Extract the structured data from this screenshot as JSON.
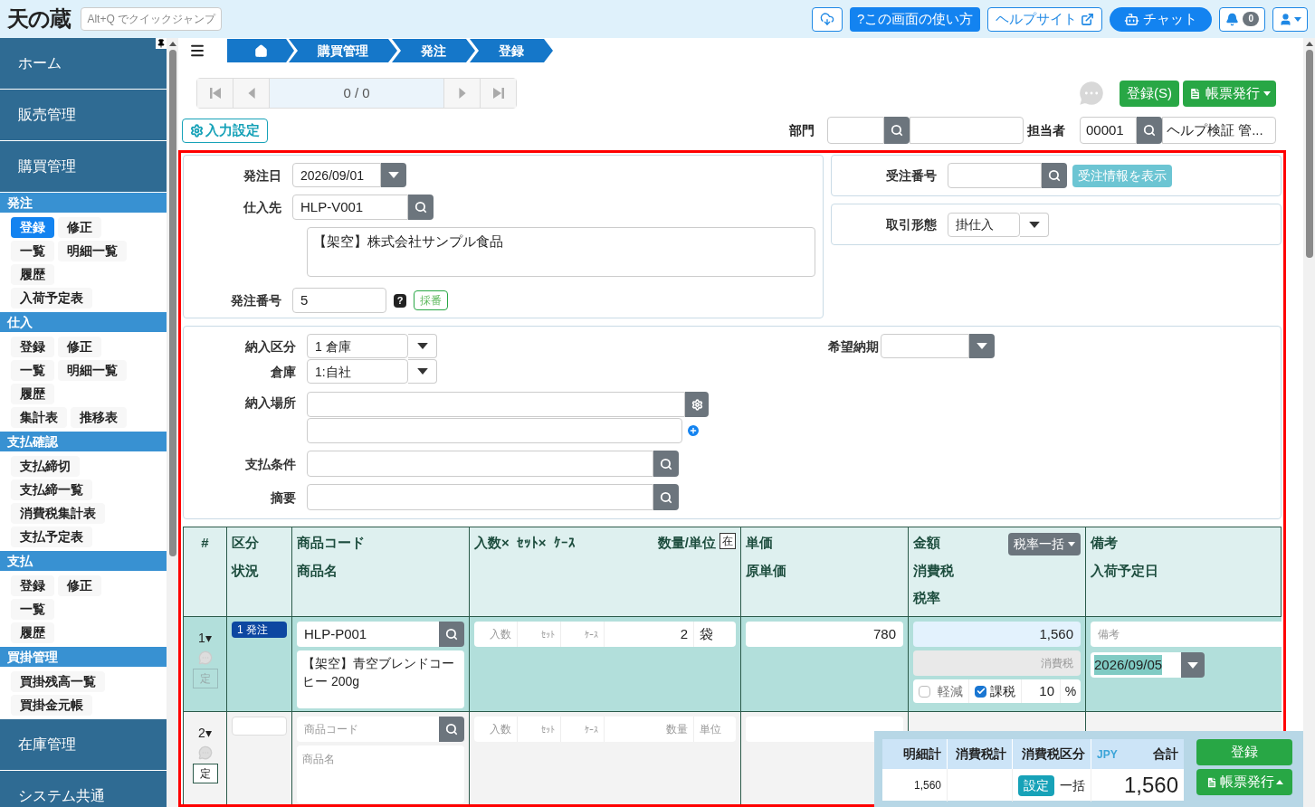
{
  "header": {
    "logo": "天の蔵",
    "quick_jump": {
      "placeholder": "Alt+Q でクイックジャンプ"
    },
    "buttons": [
      {
        "kind": "download"
      },
      {
        "kind": "help",
        "label": "?この画面の使い方"
      },
      {
        "kind": "site",
        "label": "ヘルプサイト"
      },
      {
        "kind": "chat",
        "label": "チャット"
      },
      {
        "kind": "notify",
        "badge": "0"
      },
      {
        "kind": "user"
      }
    ]
  },
  "sidebar": {
    "top": [
      {
        "label": "ホーム"
      },
      {
        "label": "販売管理"
      },
      {
        "label": "購買管理"
      }
    ],
    "sections": [
      {
        "title": "発注",
        "rows": [
          [
            {
              "label": "登録",
              "selected": true
            },
            {
              "label": "修正",
              "selected": false
            }
          ],
          [
            {
              "label": "一覧",
              "selected": false
            },
            {
              "label": "明細一覧",
              "selected": false
            }
          ],
          [
            {
              "label": "履歴",
              "selected": false
            }
          ],
          [
            {
              "label": "入荷予定表",
              "selected": false
            }
          ]
        ]
      },
      {
        "title": "仕入",
        "rows": [
          [
            {
              "label": "登録",
              "selected": false
            },
            {
              "label": "修正",
              "selected": false
            }
          ],
          [
            {
              "label": "一覧",
              "selected": false
            },
            {
              "label": "明細一覧",
              "selected": false
            }
          ],
          [
            {
              "label": "履歴",
              "selected": false
            }
          ],
          [
            {
              "label": "集計表",
              "selected": false
            },
            {
              "label": "推移表",
              "selected": false
            }
          ]
        ]
      },
      {
        "title": "支払確認",
        "rows": [
          [
            {
              "label": "支払締切",
              "selected": false
            }
          ],
          [
            {
              "label": "支払締一覧",
              "selected": false
            }
          ],
          [
            {
              "label": "消費税集計表",
              "selected": false
            }
          ],
          [
            {
              "label": "支払予定表",
              "selected": false
            }
          ]
        ]
      },
      {
        "title": "支払",
        "rows": [
          [
            {
              "label": "登録",
              "selected": false
            },
            {
              "label": "修正",
              "selected": false
            }
          ],
          [
            {
              "label": "一覧",
              "selected": false
            }
          ],
          [
            {
              "label": "履歴",
              "selected": false
            }
          ]
        ]
      },
      {
        "title": "買掛管理",
        "rows": [
          [
            {
              "label": "買掛残高一覧",
              "selected": false
            }
          ],
          [
            {
              "label": "買掛金元帳",
              "selected": false
            }
          ]
        ]
      }
    ],
    "bottom": [
      {
        "label": "在庫管理"
      },
      {
        "label": "システム共通"
      }
    ]
  },
  "breadcrumb": [
    "購買管理",
    "発注",
    "登録"
  ],
  "pager": {
    "position": "0 / 0"
  },
  "actions": {
    "register": "登録(S)",
    "print": "帳票発行"
  },
  "input_settings": "入力設定",
  "department": {
    "label": "部門"
  },
  "staff": {
    "label": "担当者",
    "code": "00001",
    "name": "ヘルプ検証 管..."
  },
  "order": {
    "date": {
      "label": "発注日",
      "value": "2026/09/01"
    },
    "supplier": {
      "label": "仕入先",
      "code": "HLP-V001",
      "name": "【架空】株式会社サンプル食品"
    },
    "number": {
      "label": "発注番号",
      "value": "5",
      "help": "?",
      "assign": "採番"
    },
    "sales_order": {
      "label": "受注番号",
      "button": "受注情報を表示"
    },
    "trade_type": {
      "label": "取引形態",
      "value": "掛仕入"
    }
  },
  "delivery": {
    "type": {
      "label": "納入区分",
      "value": "1 倉庫"
    },
    "warehouse": {
      "label": "倉庫",
      "value": "1:自社"
    },
    "desired_date": {
      "label": "希望納期"
    },
    "place": {
      "label": "納入場所"
    },
    "payment_terms": {
      "label": "支払条件"
    },
    "memo": {
      "label": "摘要"
    }
  },
  "table": {
    "columns": [
      {
        "lines": [
          "#"
        ]
      },
      {
        "lines": [
          "区分",
          "状況"
        ]
      },
      {
        "lines": [
          "商品コード",
          "商品名"
        ]
      },
      {
        "lines": [
          "入数×",
          "ｾｯﾄ×",
          "ｹｰｽ"
        ],
        "extra": "数量/単位",
        "stock": "在"
      },
      {
        "lines": [
          "単価",
          "原単価"
        ]
      },
      {
        "lines": [
          "金額",
          "消費税",
          "税率"
        ],
        "button": "税率一括"
      },
      {
        "lines": [
          "備考",
          "入荷予定日"
        ]
      }
    ],
    "rows": [
      {
        "no": "1▾",
        "selected": true,
        "fixed": {
          "label": "定",
          "disabled": true
        },
        "category": {
          "value": "1 発注"
        },
        "code": {
          "value": "HLP-P001"
        },
        "name": {
          "value": "【架空】青空ブレンドコーヒー 200g"
        },
        "irisu": {
          "placeholder": "入数"
        },
        "set": {
          "placeholder": "ｾｯﾄ"
        },
        "case": {
          "placeholder": "ｹｰｽ"
        },
        "qty": {
          "value": "2"
        },
        "unit": {
          "value": "袋"
        },
        "price": {
          "value": "780"
        },
        "amount": {
          "value": "1,560"
        },
        "tax": {
          "placeholder": "消費税"
        },
        "reduced": {
          "label": "軽減",
          "checked": false
        },
        "taxable": {
          "label": "課税",
          "checked": true
        },
        "rate": "10",
        "percent": "%",
        "note": {
          "placeholder": "備考"
        },
        "arrival": {
          "value": "2026/09/05"
        }
      },
      {
        "no": "2▾",
        "selected": false,
        "fixed": {
          "label": "定",
          "disabled": false
        },
        "category": {},
        "code": {
          "placeholder": "商品コード"
        },
        "name": {
          "placeholder": "商品名"
        },
        "irisu": {
          "placeholder": "入数"
        },
        "set": {
          "placeholder": "ｾｯﾄ"
        },
        "case": {
          "placeholder": "ｹｰｽ"
        },
        "qty": {
          "placeholder": "数量"
        },
        "unit": {
          "placeholder": "単位"
        },
        "price": {},
        "tax": {}
      }
    ]
  },
  "totals": {
    "columns": [
      "明細計",
      "消費税計",
      "消費税区分"
    ],
    "currency": "JPY",
    "total_label": "合計",
    "detail_total": "1,560",
    "tax_button": "設定",
    "tax_mode": "一括",
    "grand_total": "1,560",
    "register": "登録",
    "print": "帳票発行"
  }
}
